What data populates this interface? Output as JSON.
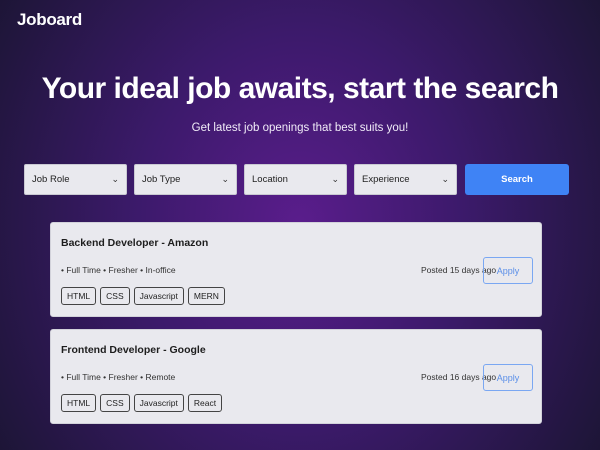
{
  "brand": "Joboard",
  "hero": {
    "title": "Your ideal job awaits, start the search",
    "subtitle": "Get latest job openings that best suits you!"
  },
  "filters": {
    "job_role": "Job Role",
    "job_type": "Job Type",
    "location": "Location",
    "experience": "Experience",
    "search_label": "Search"
  },
  "jobs": [
    {
      "title": "Backend Developer - Amazon",
      "meta": "• Full Time • Fresher • In-office",
      "posted": "Posted 15 days ago",
      "apply_label": "Apply",
      "tags": [
        "HTML",
        "CSS",
        "Javascript",
        "MERN"
      ]
    },
    {
      "title": "Frontend Developer - Google",
      "meta": "• Full Time • Fresher • Remote",
      "posted": "Posted 16 days ago",
      "apply_label": "Apply",
      "tags": [
        "HTML",
        "CSS",
        "Javascript",
        "React"
      ]
    }
  ],
  "colors": {
    "accent": "#3f83f5",
    "background_center": "#5a1d8c",
    "background_edge": "#1c1535",
    "card_bg": "#e9e9ee"
  },
  "icons": {
    "select_chevron": "chevron-down-icon"
  }
}
